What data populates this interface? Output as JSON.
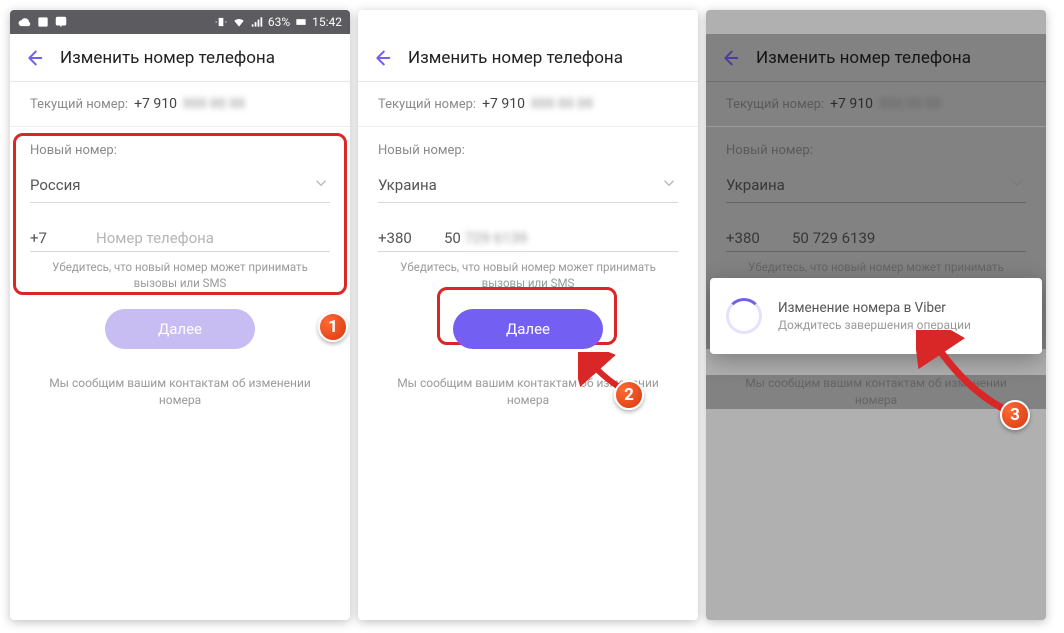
{
  "statusbar": {
    "battery": "63%",
    "time": "15:42"
  },
  "appbar": {
    "title": "Изменить номер телефона"
  },
  "current": {
    "label": "Текущий номер:",
    "value": "+7 910",
    "hidden": "888 88 88"
  },
  "form": {
    "label": "Новый номер:",
    "hint": "Убедитесь, что новый номер может принимать вызовы или SMS",
    "button": "Далее",
    "placeholder": "Номер телефона"
  },
  "screen1": {
    "country": "Россия",
    "prefix": "+7"
  },
  "screen2": {
    "country": "Украина",
    "prefix": "+380",
    "number_visible": "50",
    "number_hidden": "729 6139"
  },
  "screen3": {
    "country": "Украина",
    "prefix": "+380",
    "number": "50 729 6139"
  },
  "footnote": "Мы сообщим вашим контактам об изменении номера",
  "dialog": {
    "title": "Изменение номера в Viber",
    "subtitle": "Дождитесь завершения операции"
  },
  "badges": {
    "b1": "1",
    "b2": "2",
    "b3": "3"
  }
}
